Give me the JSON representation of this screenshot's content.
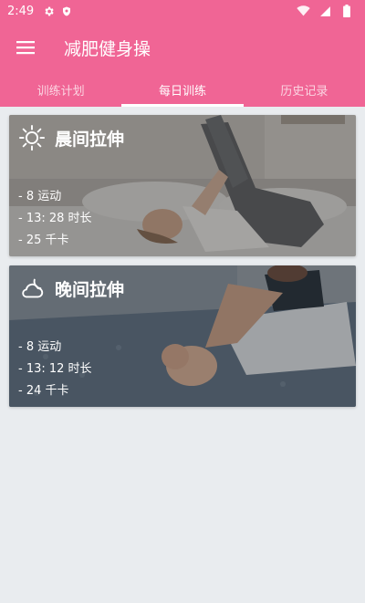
{
  "status_bar": {
    "time": "2:49"
  },
  "app_bar": {
    "title": "减肥健身操"
  },
  "tabs": [
    {
      "label": "训练计划",
      "active": false
    },
    {
      "label": "每日训练",
      "active": true
    },
    {
      "label": "历史记录",
      "active": false
    }
  ],
  "cards": [
    {
      "title": "晨间拉伸",
      "icon": "sun-icon",
      "stats": [
        "- 8 运动",
        "- 13: 28 时长",
        "- 25 千卡"
      ]
    },
    {
      "title": "晚间拉伸",
      "icon": "cloud-moon-icon",
      "stats": [
        "- 8 运动",
        "- 13: 12 时长",
        "- 24 千卡"
      ]
    }
  ],
  "colors": {
    "primary": "#f06595",
    "background": "#e9ecef"
  }
}
